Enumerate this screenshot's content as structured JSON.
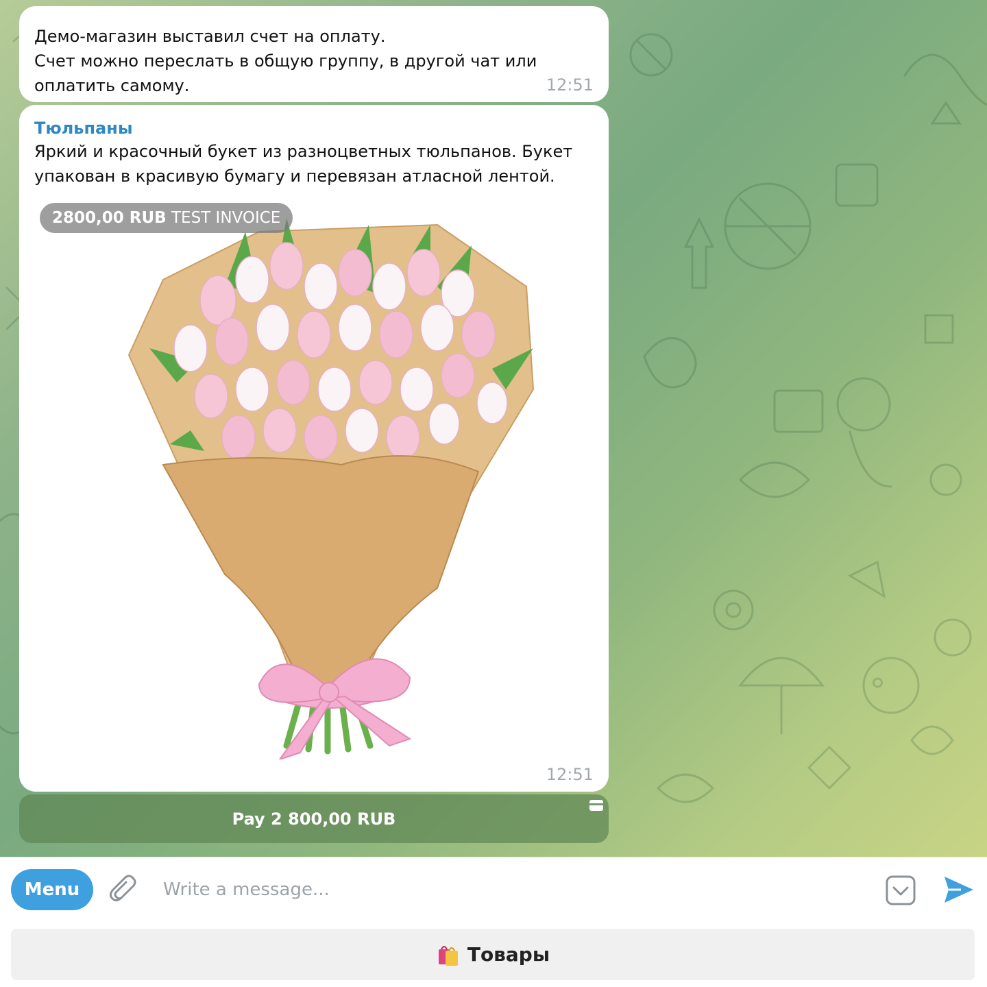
{
  "messages": {
    "notice": {
      "lines": [
        "Демо-магазин выставил счет на оплату.",
        "Счет можно переслать в общую группу, в другой чат или",
        "оплатить самому."
      ],
      "time": "12:51"
    },
    "invoice": {
      "title": "Тюльпаны",
      "description_lines": [
        "Яркий и красочный букет из разноцветных тюльпанов. Букет",
        "упакован в красивую бумагу и перевязан атласной лентой."
      ],
      "price": "2800,00 RUB",
      "price_suffix": "TEST INVOICE",
      "time": "12:51"
    }
  },
  "pay_button": {
    "label": "Pay 2 800,00 RUB",
    "icon": "credit-card-icon"
  },
  "composer": {
    "menu_label": "Menu",
    "placeholder": "Write a message...",
    "attach_icon": "paperclip-icon",
    "keyboard_icon": "bot-keyboard-icon",
    "send_icon": "send-icon"
  },
  "reply_keyboard": {
    "emoji": "🛍️",
    "label": "Товары",
    "icon": "shopping-bags-icon"
  },
  "colors": {
    "accent": "#3fa0e0",
    "title": "#2f88c4",
    "pay_button": "#5f8755"
  }
}
